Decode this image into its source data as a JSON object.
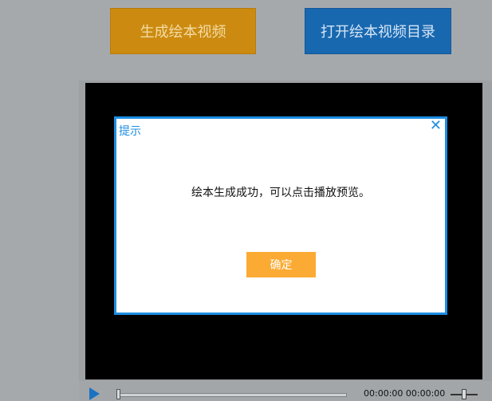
{
  "toolbar": {
    "generate_label": "生成绘本视频",
    "open_dir_label": "打开绘本视频目录"
  },
  "player": {
    "time_readout": "00:00:00 00:00:00"
  },
  "dialog": {
    "title": "提示",
    "close_glyph": "✕",
    "message": "绘本生成成功，可以点击播放预览。",
    "ok_label": "确定"
  },
  "colors": {
    "generate_button": "#cc8b10",
    "open_dir_button": "#1868b0",
    "dialog_border": "#1d8de2",
    "ok_button": "#fbab33"
  },
  "icons": {
    "play": "play-icon",
    "close": "close-icon"
  }
}
